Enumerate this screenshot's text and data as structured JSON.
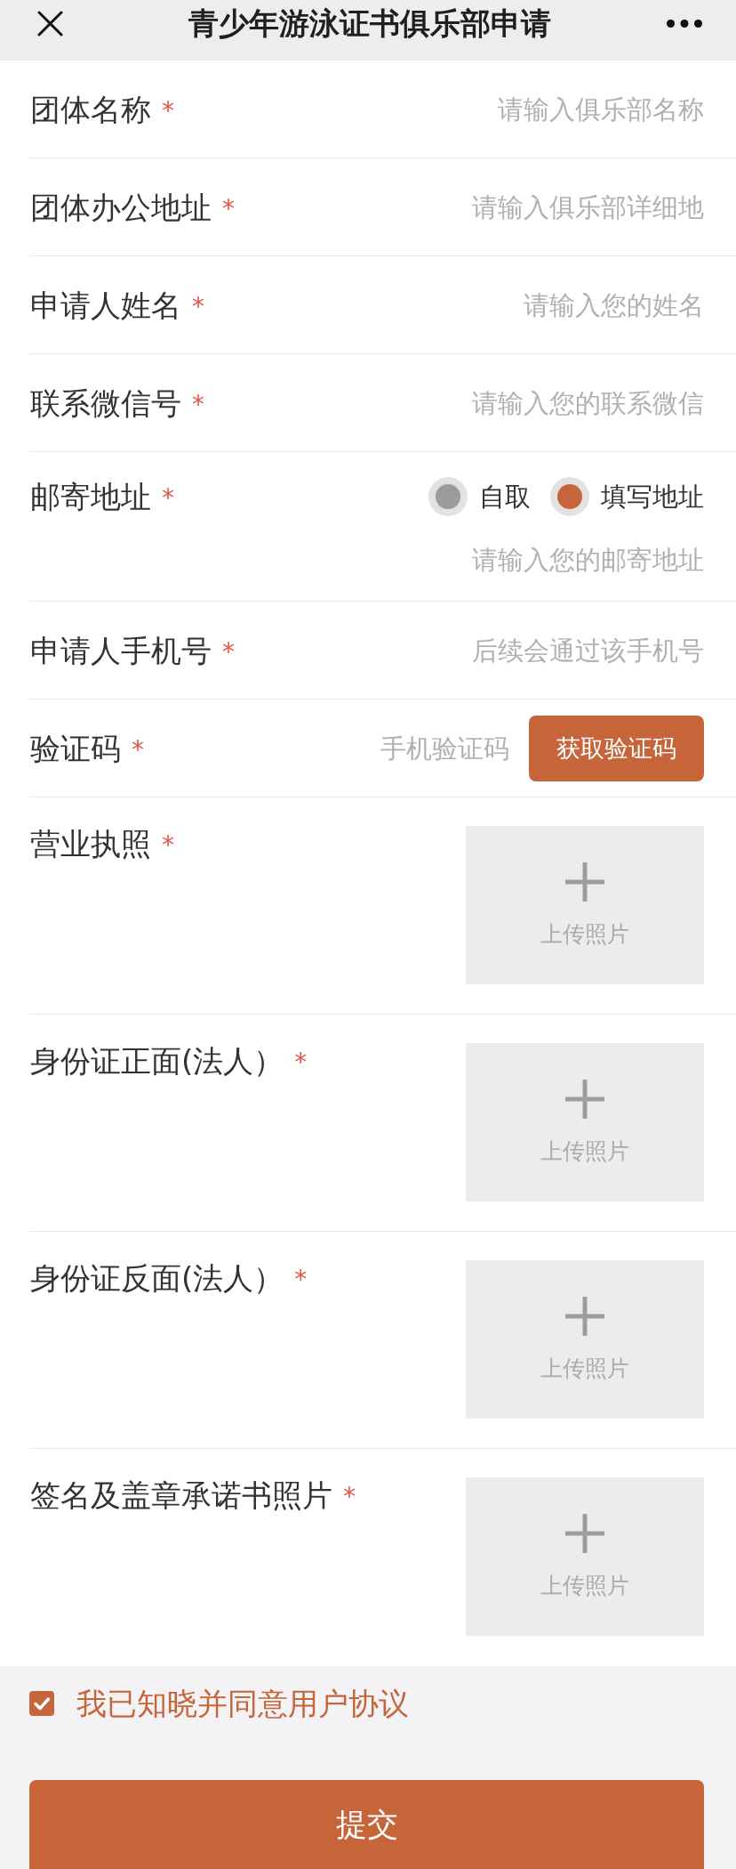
{
  "header": {
    "title": "青少年游泳证书俱乐部申请"
  },
  "form": {
    "fields": [
      {
        "kind": "text",
        "label": "团体名称",
        "required_mark": "*",
        "placeholder": "请输入俱乐部名称"
      },
      {
        "kind": "text",
        "label": "团体办公地址",
        "required_mark": "*",
        "placeholder": "请输入俱乐部详细地"
      },
      {
        "kind": "text",
        "label": "申请人姓名",
        "required_mark": "*",
        "placeholder": "请输入您的姓名"
      },
      {
        "kind": "text",
        "label": "联系微信号",
        "required_mark": "*",
        "placeholder": "请输入您的联系微信"
      },
      {
        "kind": "radio",
        "label": "邮寄地址",
        "required_mark": "*",
        "options": [
          {
            "label": "自取",
            "selected": false
          },
          {
            "label": "填写地址",
            "selected": true
          }
        ],
        "placeholder": "请输入您的邮寄地址"
      },
      {
        "kind": "text",
        "label": "申请人手机号",
        "required_mark": "*",
        "placeholder": "后续会通过该手机号"
      },
      {
        "kind": "code",
        "label": "验证码",
        "required_mark": "*",
        "placeholder": "手机验证码",
        "button": "获取验证码"
      },
      {
        "kind": "upload",
        "label": "营业执照",
        "required_mark": "*",
        "upload_text": "上传照片"
      },
      {
        "kind": "upload",
        "label": "身份证正面(法人）",
        "required_mark": "*",
        "upload_text": "上传照片"
      },
      {
        "kind": "upload",
        "label": "身份证反面(法人）",
        "required_mark": "*",
        "upload_text": "上传照片"
      },
      {
        "kind": "upload",
        "label": "签名及盖章承诺书照片",
        "required_mark": "*",
        "upload_text": "上传照片"
      }
    ]
  },
  "agreement": {
    "checked": true,
    "text": "我已知晓并同意用户协议"
  },
  "submit": {
    "label": "提交"
  }
}
